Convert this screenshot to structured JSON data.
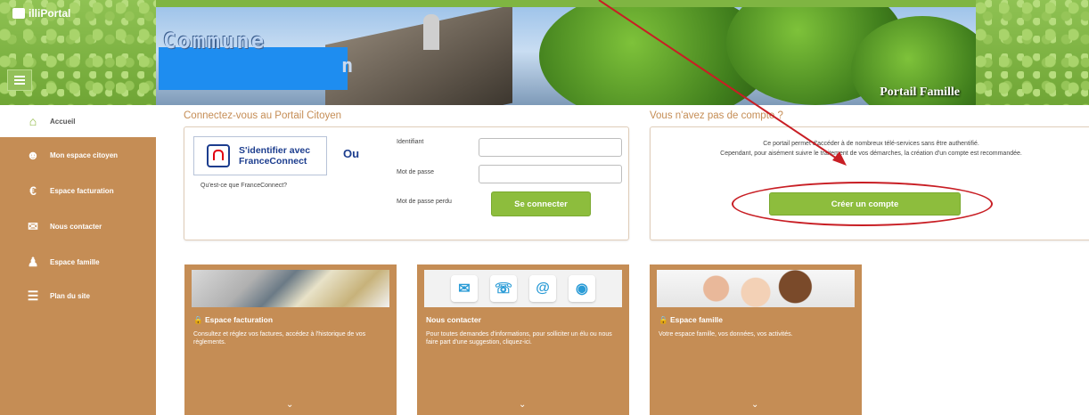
{
  "header": {
    "logo_text": "illiPortal",
    "banner_title": "Commune",
    "banner_subtitle_fragment": "n",
    "banner_tagline": "Portail Famille"
  },
  "sidebar": {
    "items": [
      {
        "label": "Accueil",
        "icon": "home-icon"
      },
      {
        "label": "Mon espace citoyen",
        "icon": "user-icon"
      },
      {
        "label": "Espace facturation",
        "icon": "euro-icon"
      },
      {
        "label": "Nous contacter",
        "icon": "envelope-icon"
      },
      {
        "label": "Espace famille",
        "icon": "family-icon"
      },
      {
        "label": "Plan du site",
        "icon": "sitemap-icon"
      }
    ]
  },
  "login": {
    "title": "Connectez-vous au Portail Citoyen",
    "franceconnect_line1": "S'identifier avec",
    "franceconnect_line2": "FranceConnect",
    "or_label": "Ou",
    "franceconnect_link": "Qu'est-ce que FranceConnect?",
    "identifier_label": "Identifiant",
    "identifier_value": "",
    "password_label": "Mot de passe",
    "password_value": "",
    "forgot_password": "Mot de passe perdu",
    "submit_label": "Se connecter"
  },
  "register": {
    "title": "Vous n'avez pas de compte ?",
    "info_line1": "Ce portail permet d'accéder à de nombreux télé-services sans être authentifié.",
    "info_line2": "Cependant, pour aisément suivre le traitement de vos démarches, la création d'un compte est recommandée.",
    "button_label": "Créer un compte"
  },
  "cards": [
    {
      "title": "Espace facturation",
      "description": "Consultez et réglez vos factures, accédez à l'historique de vos règlements."
    },
    {
      "title": "Nous contacter",
      "description": "Pour toutes demandes d'informations, pour solliciter un élu ou nous faire part d'une suggestion, cliquez-ici."
    },
    {
      "title": "Espace famille",
      "description": "Votre espace famille, vos données, vos activités."
    }
  ],
  "colors": {
    "sidebar": "#c58d55",
    "accent_green": "#8dbd3d",
    "annotation_red": "#c81e24"
  }
}
